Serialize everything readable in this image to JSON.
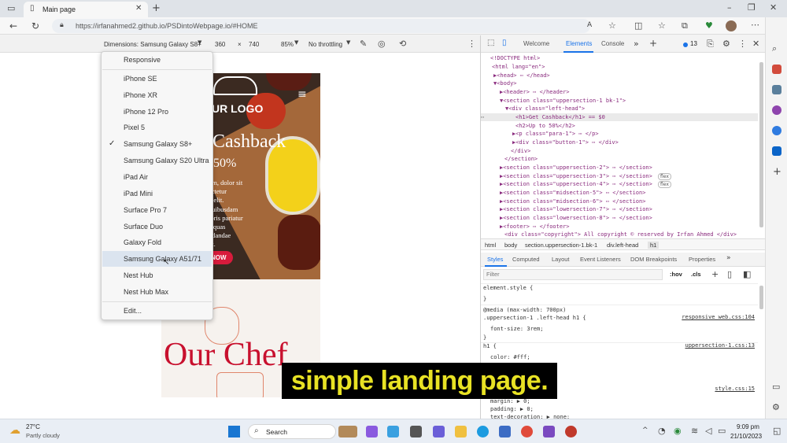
{
  "browser": {
    "tab_title": "Main page",
    "url": "https://irfanahmed2.github.io/PSDintoWebpage.io/#HOME"
  },
  "device_toolbar": {
    "dimensions_label": "Dimensions: Samsung Galaxy S8+",
    "width": "360",
    "times": "×",
    "height": "740",
    "zoom": "85%",
    "throttling": "No throttling"
  },
  "device_menu": {
    "items": [
      "Responsive",
      "iPhone SE",
      "iPhone XR",
      "iPhone 12 Pro",
      "Pixel 5",
      "Samsung Galaxy S8+",
      "Samsung Galaxy S20 Ultra",
      "iPad Air",
      "iPad Mini",
      "Surface Pro 7",
      "Surface Duo",
      "Galaxy Fold",
      "Samsung Galaxy A51/71",
      "Nest Hub",
      "Nest Hub Max"
    ],
    "checked": "Samsung Galaxy S8+",
    "hovered": "Samsung Galaxy A51/71",
    "edit_label": "Edit..."
  },
  "preview": {
    "logo": "UR LOGO",
    "headline": "Cashback",
    "subheadline": "50%",
    "para_lines": [
      "um, dolor sit",
      "ectetur",
      "y elit.",
      "quibusdam",
      "ioris pariatur",
      "e quas",
      "ndandae",
      "ut."
    ],
    "button": "NOW",
    "section_title": "Our Chef"
  },
  "devtools": {
    "tabs": [
      "Welcome",
      "Elements",
      "Console"
    ],
    "active_tab": "Elements",
    "issue_count": "13",
    "dom_lines": [
      "<!DOCTYPE html>",
      "<html lang=\"en\">",
      "▶<head> ⋯ </head>",
      "▼<body>",
      "▶<header> ⋯ </header>",
      "▼<section class=\"uppersection-1 bk-1\">",
      "▼<div class=\"left-head\">",
      "<h1>Get Cashback</h1> == $0",
      "<h2>Up to 50%</h2>",
      "▶<p class=\"para-1\"> ⋯ </p>",
      "▶<div class=\"button-1\"> ⋯ </div>",
      "</div>",
      "</section>",
      "▶<section class=\"uppersection-2\"> ⋯ </section>",
      "▶<section class=\"uppersection-3\"> ⋯ </section>",
      "▶<section class=\"uppersection-4\"> ⋯ </section>",
      "▶<section class=\"midsection-5\"> ⋯ </section>",
      "▶<section class=\"midsection-6\"> ⋯ </section>",
      "▶<section class=\"lowersection-7\"> ⋯ </section>",
      "▶<section class=\"lowersection-8\"> ⋯ </section>",
      "▶<footer> ⋯ </footer>",
      "<div class=\"copyright\"> All copyright © reserved by Irfan Ahmed </div>"
    ],
    "flex_badge": "flex",
    "breadcrumbs": [
      "html",
      "body",
      "section.uppersection-1.bk-1",
      "div.left-head",
      "h1"
    ],
    "style_tabs": [
      "Styles",
      "Computed",
      "Layout",
      "Event Listeners",
      "DOM Breakpoints",
      "Properties"
    ],
    "filter_placeholder": "Filter",
    "hov": ":hov",
    "cls": ".cls",
    "css_lines": [
      "element.style {",
      "}",
      "@media (max-width: 700px)",
      ".uppersection-1 .left-head h1 {",
      "font-size: 3rem;",
      "}",
      "h1 {",
      "color: #fff;",
      "margin: ▶ 0;",
      "padding: ▶ 0;",
      "text-decoration: ▶ none;"
    ],
    "css_sources": [
      "responsive_web.css:104",
      "uppersection-1.css:13",
      "style.css:15"
    ]
  },
  "caption": "simple landing page.",
  "taskbar": {
    "temperature": "27°C",
    "weather": "Partly cloudy",
    "search": "Search",
    "time": "9:09 pm",
    "date": "21/10/2023"
  }
}
